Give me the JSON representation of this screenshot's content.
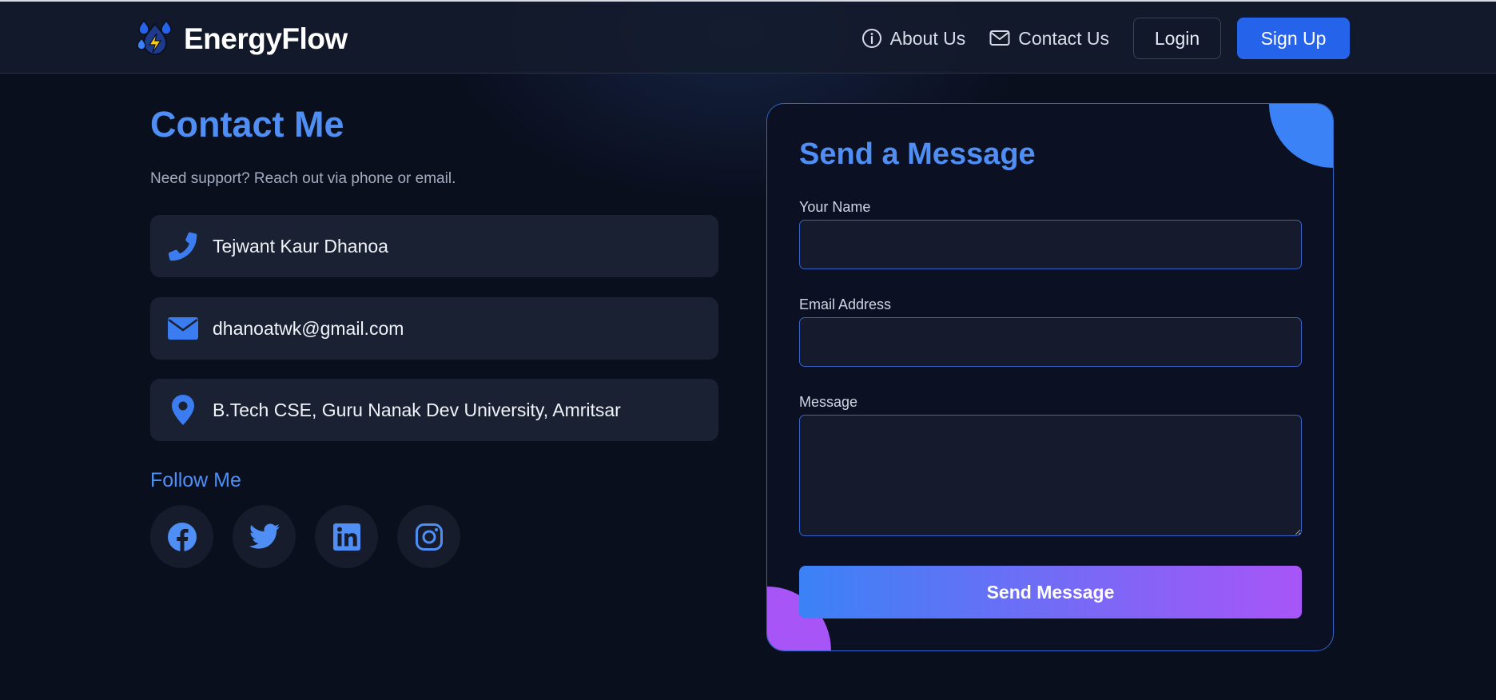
{
  "navbar": {
    "brand": "EnergyFlow",
    "about_label": "About Us",
    "contact_label": "Contact Us",
    "login_label": "Login",
    "signup_label": "Sign Up"
  },
  "contact": {
    "title": "Contact Me",
    "subtitle": "Need support? Reach out via phone or email.",
    "cards": [
      {
        "icon": "phone-icon",
        "text": "Tejwant Kaur Dhanoa"
      },
      {
        "icon": "envelope-icon",
        "text": "dhanoatwk@gmail.com"
      },
      {
        "icon": "map-pin-icon",
        "text": "B.Tech CSE, Guru Nanak Dev University, Amritsar"
      }
    ],
    "follow_title": "Follow Me",
    "socials": [
      "facebook-icon",
      "twitter-icon",
      "linkedin-icon",
      "instagram-icon"
    ]
  },
  "form": {
    "title": "Send a Message",
    "name_label": "Your Name",
    "name_value": "",
    "email_label": "Email Address",
    "email_value": "",
    "message_label": "Message",
    "message_value": "",
    "submit_label": "Send Message"
  },
  "colors": {
    "background": "#0a0f1e",
    "accent": "#4f8ff5",
    "primary_button": "#2563eb",
    "gradient_start": "#3b82f6",
    "gradient_end": "#a855f7"
  }
}
